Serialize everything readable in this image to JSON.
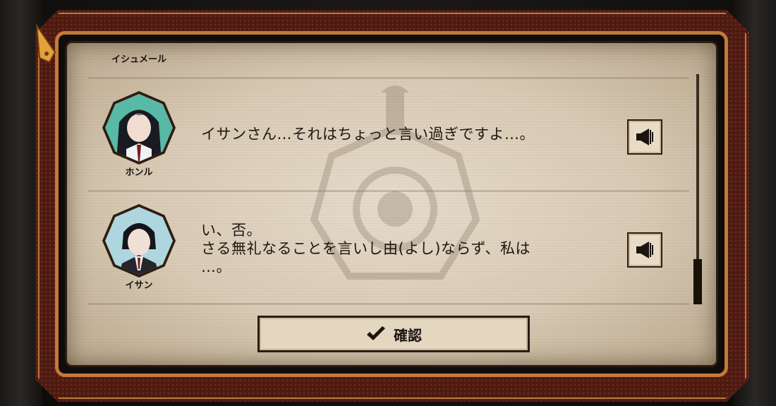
{
  "log": {
    "top_name": "イシュメール",
    "entries": [
      {
        "speaker": "ホンル",
        "lines": [
          "イサンさん…それはちょっと言い過ぎですよ…。"
        ]
      },
      {
        "speaker": "イサン",
        "lines": [
          "い、否。",
          "さる無礼なることを言いし由(よし)ならず、私は",
          "…。"
        ]
      }
    ],
    "voice_icon": "speaker-icon"
  },
  "confirm": {
    "label": "確認",
    "icon": "check-icon"
  },
  "colors": {
    "frame": "#4a1b12",
    "accent": "#c27a3a",
    "paper": "#e6dccb"
  }
}
